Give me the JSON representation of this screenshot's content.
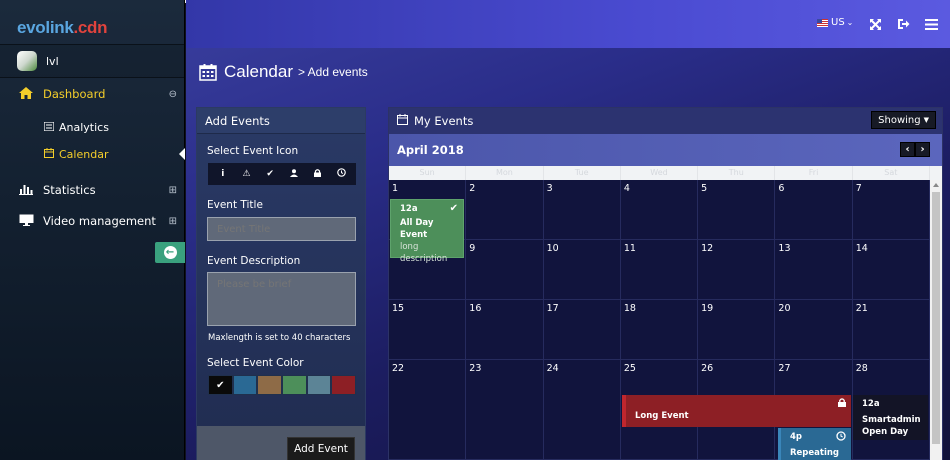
{
  "brand": {
    "part1": "evolink",
    "part2": ".cdn"
  },
  "user": {
    "name": "lvl"
  },
  "sidebar": {
    "dashboard": "Dashboard",
    "analytics": "Analytics",
    "calendar": "Calendar",
    "statistics": "Statistics",
    "video": "Video management"
  },
  "topbar": {
    "language": "US"
  },
  "page": {
    "title": "Calendar",
    "subtitle": "> Add events"
  },
  "add_events": {
    "heading": "Add Events",
    "icon_label": "Select Event Icon",
    "title_label": "Event Title",
    "title_placeholder": "Event Title",
    "desc_label": "Event Description",
    "desc_placeholder": "Please be brief",
    "help": "Maxlength is set to 40 characters",
    "color_label": "Select Event Color",
    "colors": [
      "#0a0a0a",
      "#2a6994",
      "#8e6b47",
      "#4d8f5a",
      "#5c8496",
      "#8d1f25"
    ],
    "button": "Add Event"
  },
  "my_events": {
    "heading": "My Events",
    "showing": "Showing",
    "month": "April 2018",
    "weekdays": [
      "Sun",
      "Mon",
      "Tue",
      "Wed",
      "Thu",
      "Fri",
      "Sat"
    ],
    "days": [
      [
        1,
        2,
        3,
        4,
        5,
        6,
        7
      ],
      [
        8,
        9,
        10,
        11,
        12,
        13,
        14
      ],
      [
        15,
        16,
        17,
        18,
        19,
        20,
        21
      ],
      [
        22,
        23,
        24,
        25,
        26,
        27,
        28
      ]
    ],
    "events": {
      "allday": {
        "time": "12a",
        "title": "All Day Event",
        "desc": "long description"
      },
      "long": {
        "title": "Long Event"
      },
      "repeat": {
        "time": "4p",
        "title": "Repeating"
      },
      "smart": {
        "time": "12a",
        "title": "Smartadmin Open Day"
      }
    }
  }
}
